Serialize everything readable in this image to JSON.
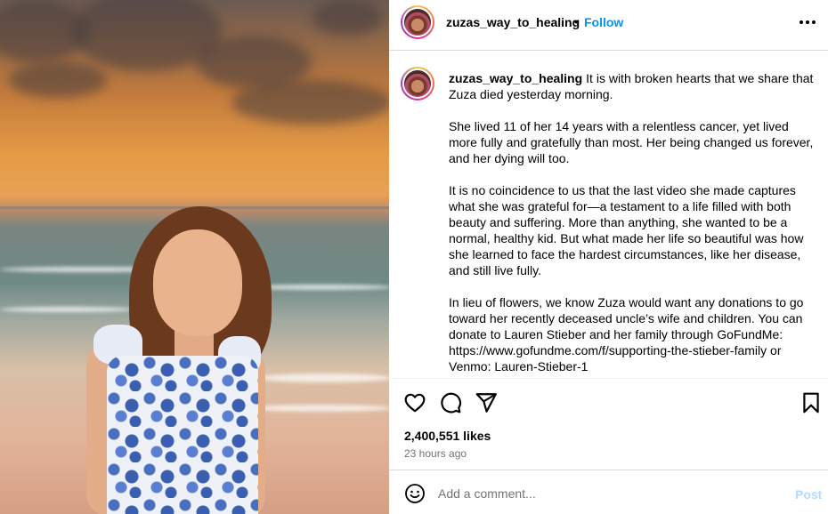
{
  "post": {
    "username": "zuzas_way_to_healing",
    "follow_label": "Follow",
    "dot": "•"
  },
  "caption": {
    "username": "zuzas_way_to_healing",
    "paragraphs": [
      "It is with broken hearts that we share that Zuza died yesterday morning.",
      "She lived 11 of her 14 years with a relentless cancer, yet lived more fully and gratefully than most. Her being changed us forever, and her dying will too.",
      "It is no coincidence to us that the last video she made captures what she was grateful for—a testament to a life filled with both beauty and suffering. More than anything, she wanted to be a normal, healthy kid. But what made her life so beautiful was how she learned to face the hardest circumstances, like her disease, and still live fully.",
      "In lieu of flowers, we know Zuza would want any donations to go toward her recently deceased uncle’s wife and children. You can donate to Lauren Stieber and her family through GoFundMe: https://www.gofundme.com/f/supporting-the-stieber-family or Venmo: Lauren-Stieber-1"
    ]
  },
  "engagement": {
    "likes": "2,400,551 likes",
    "time": "23 hours ago"
  },
  "comment": {
    "placeholder": "Add a comment...",
    "post_label": "Post"
  },
  "icons": {
    "like": "heart-icon",
    "comment": "comment-icon",
    "share": "share-icon",
    "save": "bookmark-icon",
    "more": "more-icon",
    "emoji": "emoji-icon"
  },
  "colors": {
    "link": "#0095f6",
    "post_disabled": "#b3dbff",
    "muted": "#737373"
  }
}
